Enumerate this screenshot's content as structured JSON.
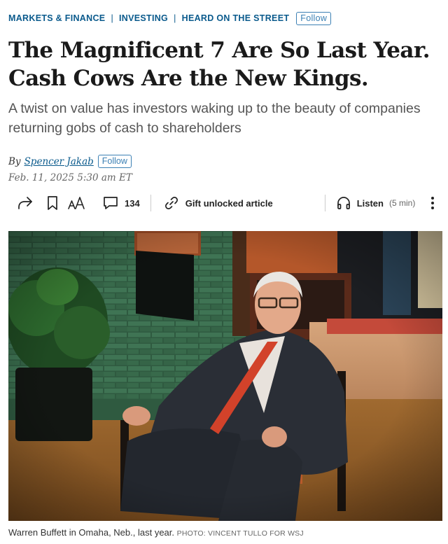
{
  "breadcrumbs": {
    "items": [
      "MARKETS & FINANCE",
      "INVESTING",
      "HEARD ON THE STREET"
    ],
    "follow_label": "Follow"
  },
  "article": {
    "headline": "The Magnificent 7 Are So Last Year. Cash Cows Are the New Kings.",
    "dek": "A twist on value has investors waking up to the beauty of companies returning gobs of cash to shareholders",
    "byline_prefix": "By",
    "author": "Spencer Jakab",
    "author_follow_label": "Follow",
    "date": "Feb. 11, 2025 5:30 am ET"
  },
  "toolbar": {
    "share_icon": "share-icon",
    "bookmark_icon": "bookmark-icon",
    "text_size_icon": "text-size-icon",
    "comments_icon": "comment-icon",
    "comment_count": "134",
    "gift_icon": "link-icon",
    "gift_label": "Gift unlocked article",
    "listen_icon": "headphones-icon",
    "listen_label": "Listen",
    "listen_duration": "(5 min)",
    "more_icon": "more-vertical-icon"
  },
  "photo": {
    "caption": "Warren Buffett in Omaha, Neb., last year.",
    "credit": "PHOTO: VINCENT TULLO FOR WSJ"
  },
  "colors": {
    "link_blue": "#0a5a8c",
    "follow_border": "#3c80b4",
    "headline": "#1a1a1a",
    "dek": "#555555"
  }
}
